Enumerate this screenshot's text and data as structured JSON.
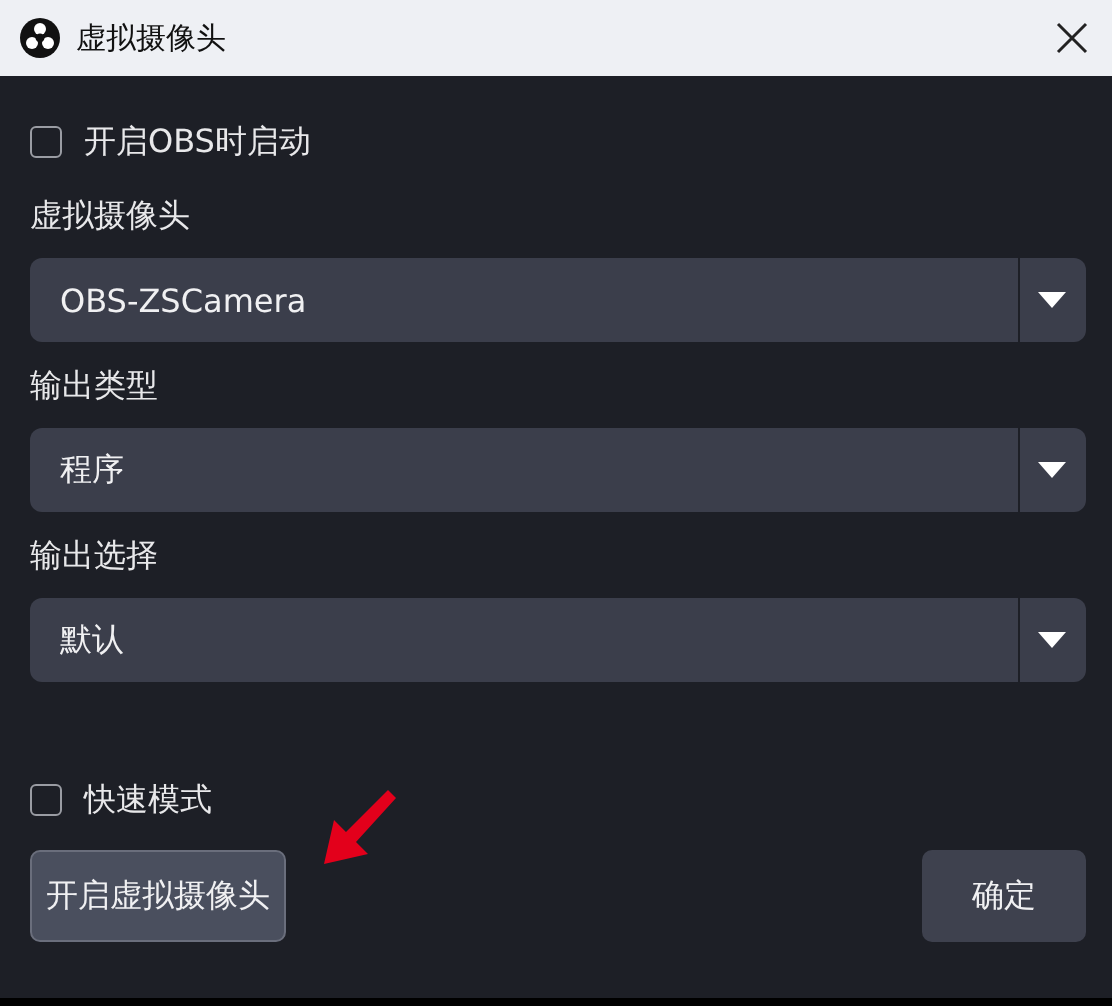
{
  "window": {
    "title": "虚拟摄像头"
  },
  "start_with_obs": {
    "label": "开启OBS时启动",
    "checked": false
  },
  "fields": [
    {
      "label": "虚拟摄像头",
      "value": "OBS-ZSCamera"
    },
    {
      "label": "输出类型",
      "value": "程序"
    },
    {
      "label": "输出选择",
      "value": "默认"
    }
  ],
  "fast_mode": {
    "label": "快速模式",
    "checked": false
  },
  "buttons": [
    {
      "label": "开启虚拟摄像头",
      "kind": "start"
    },
    {
      "label": "确定",
      "kind": "ok"
    }
  ]
}
